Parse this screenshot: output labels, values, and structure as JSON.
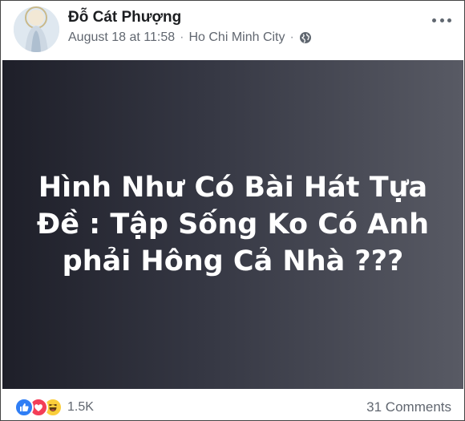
{
  "post": {
    "author_name": "Đỗ Cát Phượng",
    "date": "August 18 at 11:58",
    "separator": "·",
    "location": "Ho Chi Minh City",
    "privacy_icon": "globe-icon",
    "menu_icon": "more-options-icon",
    "content_text": "Hình Như Có Bài Hát Tựa Đề : Tập Sống Ko Có Anh phải Hông Cả Nhà ???",
    "reactions": [
      "like-icon",
      "love-icon",
      "haha-icon"
    ],
    "reaction_count": "1.5K",
    "comments_count": "31 Comments"
  },
  "colors": {
    "card_gradient_start": "#1e1f29",
    "card_gradient_end": "#585a64",
    "like": "#2f7ef5",
    "love": "#f33e58",
    "haha": "#fbce3b",
    "meta_text": "#616770"
  }
}
